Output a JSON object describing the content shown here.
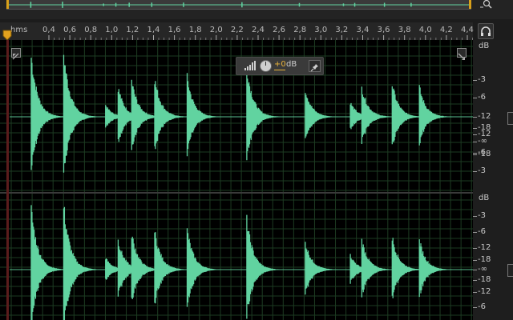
{
  "colors": {
    "waveform": "#61d3a0",
    "grid": "#1d3b22",
    "playhead": "#e3a21e",
    "accent": "#e8b23a"
  },
  "ruler": {
    "unit": "hms",
    "ticks": [
      "0,4",
      "0,6",
      "0,8",
      "1,0",
      "1,2",
      "1,4",
      "1,6",
      "1,8",
      "2,0",
      "2,2",
      "2,4",
      "2,6",
      "2,8",
      "3,0",
      "3,2",
      "3,4",
      "3,6",
      "3,8",
      "4,0",
      "4,2",
      "4,4"
    ]
  },
  "db_scale": {
    "channel_top": {
      "title": "dB",
      "labels": [
        "-3",
        "-6",
        "-12",
        "-18",
        "-∞",
        "-18",
        "-12",
        "-6",
        "-3"
      ]
    },
    "channel_bottom": {
      "title": "dB",
      "labels": [
        "-3",
        "-6",
        "-12",
        "-18",
        "-∞",
        "-18",
        "-12",
        "-6"
      ]
    }
  },
  "hud": {
    "amplitude_value": "+0",
    "unit": "dB"
  },
  "icons": {
    "zoom": "zoom-magnifier-icon",
    "headphones": "headphones-icon",
    "level_meter": "level-meter-icon",
    "volume_knob": "volume-knob-icon",
    "pin": "pin-icon",
    "corner": "corner-resize-icon"
  },
  "hits": [
    {
      "t": 0.27,
      "a": 0.92
    },
    {
      "t": 0.58,
      "a": 0.97
    },
    {
      "t": 0.98,
      "a": 0.18
    },
    {
      "t": 1.1,
      "a": 0.45
    },
    {
      "t": 1.23,
      "a": 0.55
    },
    {
      "t": 1.45,
      "a": 0.58
    },
    {
      "t": 1.76,
      "a": 0.6
    },
    {
      "t": 2.33,
      "a": 0.75
    },
    {
      "t": 2.89,
      "a": 0.42
    },
    {
      "t": 3.32,
      "a": 0.22
    },
    {
      "t": 3.43,
      "a": 0.45
    },
    {
      "t": 3.72,
      "a": 0.5
    },
    {
      "t": 3.98,
      "a": 0.45
    }
  ]
}
